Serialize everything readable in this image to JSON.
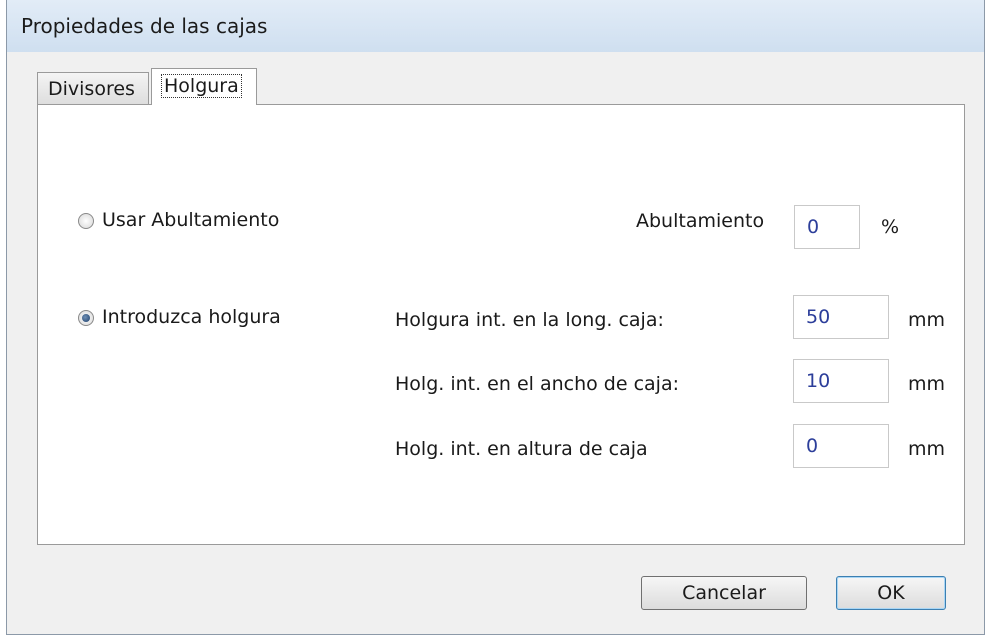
{
  "window": {
    "title": "Propiedades de las cajas"
  },
  "tabs": [
    {
      "label": "Divisores",
      "active": false
    },
    {
      "label": "Holgura",
      "active": true
    }
  ],
  "options": {
    "usar_abultamiento": {
      "label": "Usar Abultamiento",
      "checked": false
    },
    "introduzca_holgura": {
      "label": "Introduzca holgura",
      "checked": true
    }
  },
  "abultamiento": {
    "label": "Abultamiento",
    "value": "0",
    "unit": "%"
  },
  "fields": [
    {
      "label": "Holgura int. en la long. caja:",
      "value": "50",
      "unit": "mm"
    },
    {
      "label": "Holg. int. en el ancho de caja:",
      "value": "10",
      "unit": "mm"
    },
    {
      "label": "Holg. int. en altura de caja",
      "value": "0",
      "unit": "mm"
    }
  ],
  "buttons": {
    "cancel": "Cancelar",
    "ok": "OK"
  }
}
